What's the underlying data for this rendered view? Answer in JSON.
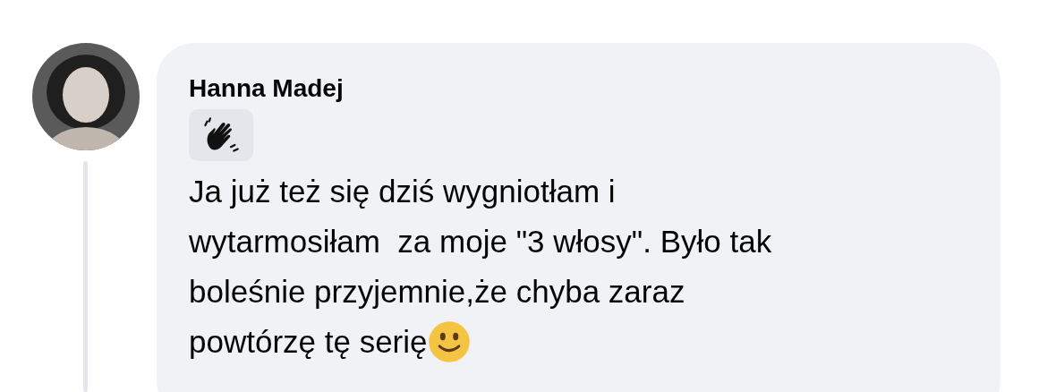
{
  "comment": {
    "author": "Hanna Madej",
    "lines": [
      "Ja już też się dziś wygniotłam i",
      "wytarmosiłam  za moje \"3 włosy\". Było tak",
      "boleśnie przyjemnie,że chyba zaraz",
      "powtórzę tę serię"
    ]
  }
}
